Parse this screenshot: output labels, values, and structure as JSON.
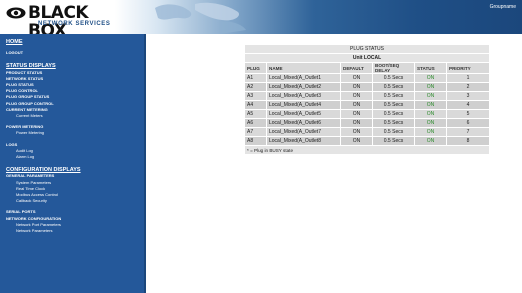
{
  "header": {
    "logo_word": "BLACK BOX",
    "logo_sub": "NETWORK SERVICES",
    "user_link": "Groupname"
  },
  "sidebar": {
    "home": "HOME",
    "logout": "LOGOUT",
    "status_title": "STATUS DISPLAYS",
    "status_items": [
      "PRODUCT STATUS",
      "NETWORK STATUS",
      "PLUG STATUS",
      "PLUG CONTROL",
      "PLUG GROUP STATUS",
      "PLUG GROUP CONTROL",
      "CURRENT METERING"
    ],
    "current_sub": [
      "Current Meters"
    ],
    "power_title": "POWER METERING",
    "power_sub": [
      "Power Metering"
    ],
    "logs_title": "LOGS",
    "logs_sub": [
      "Audit Log",
      "Alarm Log"
    ],
    "config_title": "CONFIGURATION DISPLAYS",
    "general_title": "GENERAL PARAMETERS",
    "general_sub": [
      "System Parameters",
      "Real Time Clock",
      "Modbus Access Control",
      "Callback Security"
    ],
    "serial_title": "SERIAL PORTS",
    "netconf_title": "NETWORK CONFIGURATION",
    "netconf_sub": [
      "Network Port Parameters",
      "Network Parameters"
    ]
  },
  "plug_status": {
    "title": "PLUG STATUS",
    "unit": "Unit LOCAL",
    "columns": [
      "PLUG",
      "NAME",
      "DEFAULT",
      "BOOT/SEQ DELAY",
      "STATUS",
      "PRIORITY"
    ],
    "rows": [
      {
        "plug": "A1",
        "name": "Local_Mixed(A_Outlet1",
        "default": "ON",
        "delay": "0.5 Secs",
        "status": "ON",
        "priority": "1"
      },
      {
        "plug": "A2",
        "name": "Local_Mixed(A_Outlet2",
        "default": "ON",
        "delay": "0.5 Secs",
        "status": "ON",
        "priority": "2"
      },
      {
        "plug": "A3",
        "name": "Local_Mixed(A_Outlet3",
        "default": "ON",
        "delay": "0.5 Secs",
        "status": "ON",
        "priority": "3"
      },
      {
        "plug": "A4",
        "name": "Local_Mixed(A_Outlet4",
        "default": "ON",
        "delay": "0.5 Secs",
        "status": "ON",
        "priority": "4"
      },
      {
        "plug": "A5",
        "name": "Local_Mixed(A_Outlet5",
        "default": "ON",
        "delay": "0.5 Secs",
        "status": "ON",
        "priority": "5"
      },
      {
        "plug": "A6",
        "name": "Local_Mixed(A_Outlet6",
        "default": "ON",
        "delay": "0.5 Secs",
        "status": "ON",
        "priority": "6"
      },
      {
        "plug": "A7",
        "name": "Local_Mixed(A_Outlet7",
        "default": "ON",
        "delay": "0.5 Secs",
        "status": "ON",
        "priority": "7"
      },
      {
        "plug": "A8",
        "name": "Local_Mixed(A_Outlet8",
        "default": "ON",
        "delay": "0.5 Secs",
        "status": "ON",
        "priority": "8"
      }
    ],
    "footnote": "* = Plug in BUSY state"
  },
  "colors": {
    "sidebar_bg": "#24589a",
    "status_on": "#2b8a2b",
    "table_bg": "#d9d9d9"
  }
}
